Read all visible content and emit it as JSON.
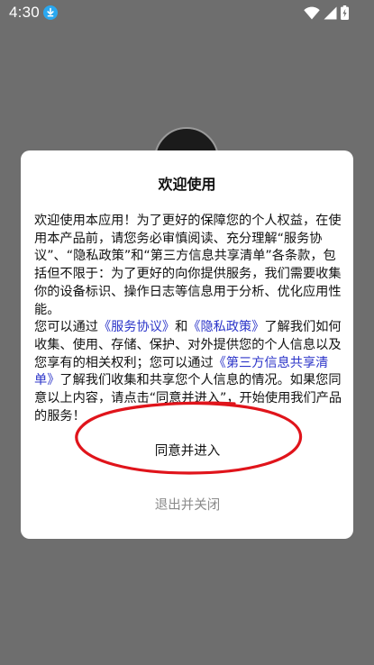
{
  "status_bar": {
    "time": "4:30",
    "icons": [
      "download-icon",
      "wifi-icon",
      "cell-signal-icon",
      "battery-charging-icon"
    ]
  },
  "dialog": {
    "title": "欢迎使用",
    "p1": "欢迎使用本应用！为了更好的保障您的个人权益，在使用本产品前，请您务必审慎阅读、充分理解“服务协议”、“隐私政策”和“第三方信息共享清单”各条款，包括但不限于：为了更好的向你提供服务，我们需要收集你的设备标识、操作日志等信息用于分析、优化应用性能。",
    "p2_a": "您可以通过",
    "link_service": "《服务协议》",
    "p2_b": "和",
    "link_privacy": "《隐私政策》",
    "p2_c": "了解我们如何收集、使用、存储、保护、对外提供您的个人信息以及您享有的相关权利；您可以通过",
    "link_third_party": "《第三方信息共享清单》",
    "p2_d": "了解我们收集和共享您个人信息的情况。如果您同意以上内容，请点击“同意并进入”，开始使用我们产品的服务！",
    "agree_label": "同意并进入",
    "exit_label": "退出并关闭"
  },
  "colors": {
    "backdrop": "#6e6e6e",
    "link": "#2c35c9",
    "annotation_circle": "#e0141b",
    "exit_text": "#8a8a8a"
  }
}
